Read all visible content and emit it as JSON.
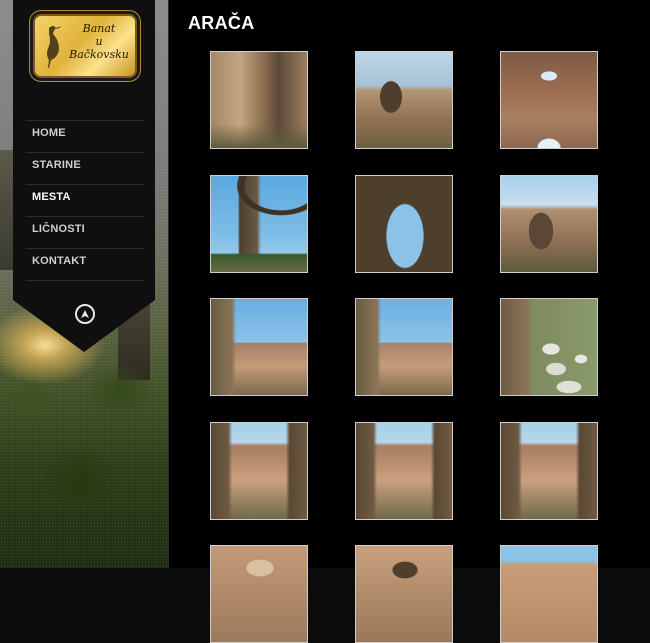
{
  "logo": {
    "line1": "Banat",
    "line2": "u",
    "line3": "Bačkovsku"
  },
  "nav": [
    {
      "label": "HOME",
      "active": false
    },
    {
      "label": "STARINE",
      "active": false
    },
    {
      "label": "MESTA",
      "active": true
    },
    {
      "label": "LIČNOSTI",
      "active": false
    },
    {
      "label": "KONTAKT",
      "active": false
    }
  ],
  "page": {
    "title": "ARAČA"
  },
  "icons": {
    "scroll_top": "up-arrow-circle-icon"
  },
  "colors": {
    "background": "#000000",
    "sidebar": "#0f0f0f",
    "text": "#ffffff",
    "nav_text": "#cfcfcf"
  },
  "gallery": {
    "columns": 3,
    "thumb_count": 15
  }
}
